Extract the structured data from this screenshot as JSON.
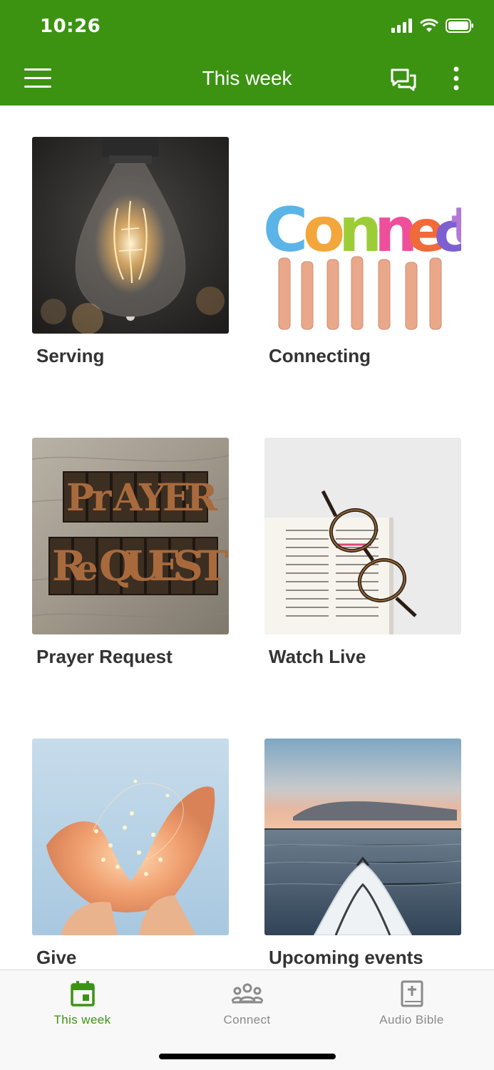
{
  "status_bar": {
    "time": "10:26"
  },
  "app_bar": {
    "title": "This week"
  },
  "tiles": [
    {
      "label": "Serving",
      "image": "light-bulb"
    },
    {
      "label": "Connecting",
      "image": "connect-hands"
    },
    {
      "label": "Prayer Request",
      "image": "prayer-request-letters"
    },
    {
      "label": "Watch Live",
      "image": "glasses-on-bible"
    },
    {
      "label": "Give",
      "image": "hands-holding-lights"
    },
    {
      "label": "Upcoming events",
      "image": "kayak-on-water"
    }
  ],
  "bottom_nav": {
    "items": [
      {
        "label": "This week",
        "icon": "calendar-icon",
        "active": true
      },
      {
        "label": "Connect",
        "icon": "group-icon",
        "active": false
      },
      {
        "label": "Audio Bible",
        "icon": "bible-icon",
        "active": false
      }
    ]
  },
  "colors": {
    "brand": "#3c9312",
    "active_tab": "#3c9312",
    "inactive_tab": "#8a8a8a"
  }
}
